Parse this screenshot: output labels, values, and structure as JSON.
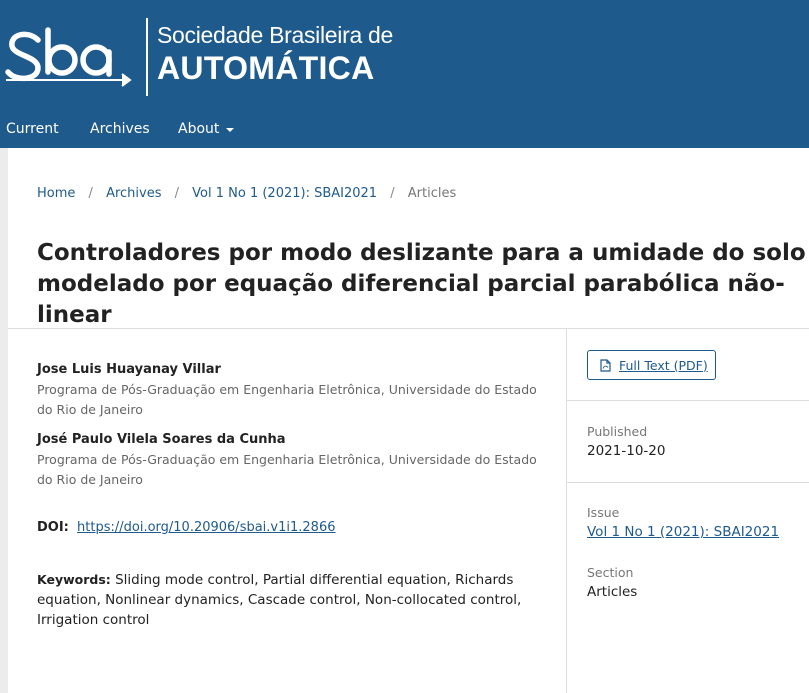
{
  "header": {
    "logo": {
      "mark_text": "SBA",
      "line1": "Sociedade Brasileira de",
      "line2": "AUTOMÁTICA"
    },
    "nav": [
      {
        "label": "Current"
      },
      {
        "label": "Archives"
      },
      {
        "label": "About"
      }
    ]
  },
  "breadcrumb": {
    "items": [
      "Home",
      "Archives",
      "Vol 1 No 1 (2021): SBAI2021"
    ],
    "separator": "/",
    "current": "Articles"
  },
  "article": {
    "title": "Controladores por modo deslizante para a umidade do solo modelado por equação diferencial parcial parabólica não-linear",
    "authors": [
      {
        "name": "Jose Luis Huayanay Villar",
        "affiliation": "Programa de Pós-Graduação em Engenharia Eletrônica, Universidade do Estado do Rio de Janeiro"
      },
      {
        "name": "José Paulo Vilela Soares da Cunha",
        "affiliation": "Programa de Pós-Graduação em Engenharia Eletrônica, Universidade do Estado do Rio de Janeiro"
      }
    ],
    "doi_label": "DOI:",
    "doi_link": "https://doi.org/10.20906/sbai.v1i1.2866",
    "keywords_label": "Keywords:",
    "keywords": "Sliding mode control, Partial differential equation, Richards equation, Nonlinear dynamics, Cascade control, Non-collocated control, Irrigation control"
  },
  "sidebar": {
    "pdf_button": "Full Text (PDF)",
    "published_label": "Published",
    "published_value": "2021-10-20",
    "issue_label": "Issue",
    "issue_value": "Vol 1 No 1 (2021): SBAI2021",
    "section_label": "Section",
    "section_value": "Articles"
  },
  "colors": {
    "header_bg": "#1f5a8d",
    "link": "#1f5a8d",
    "page_bg": "#ececec"
  }
}
